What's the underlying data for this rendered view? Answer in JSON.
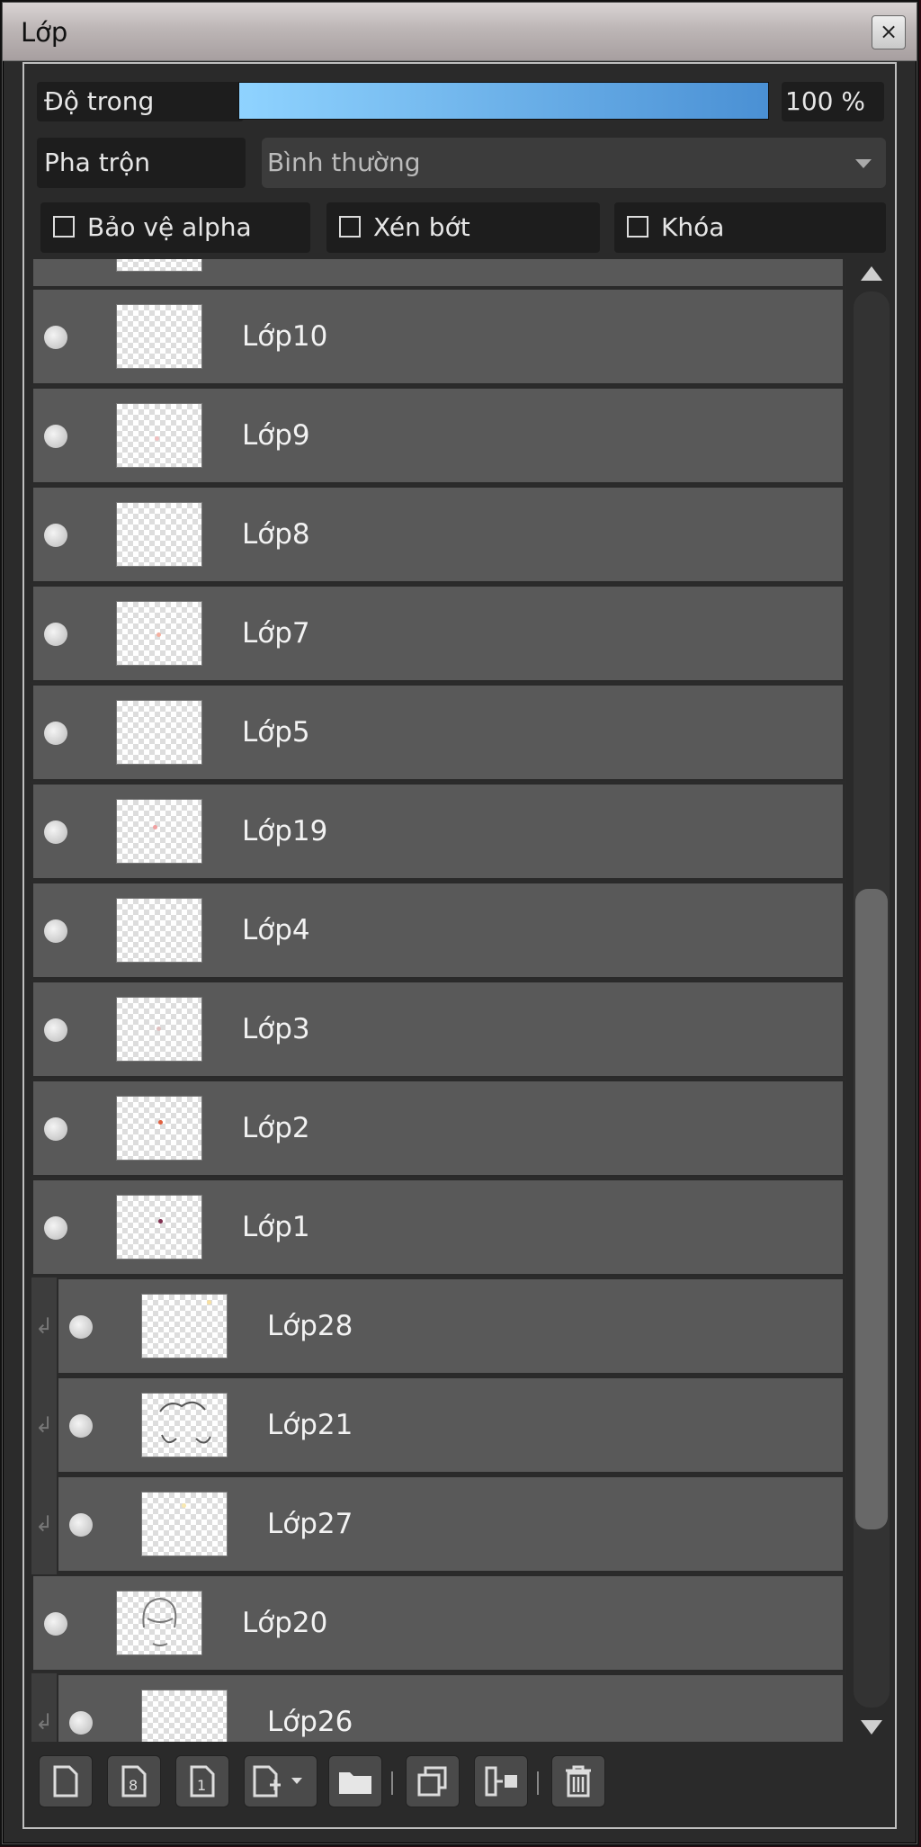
{
  "window": {
    "title": "Lớp",
    "close_symbol": "×"
  },
  "controls": {
    "opacity_label": "Độ trong",
    "opacity_value": "100 %",
    "opacity_fraction": 1.0,
    "blend_label": "Pha trộn",
    "blend_value": "Bình thường",
    "checkboxes": [
      {
        "label": "Bảo vệ alpha",
        "checked": false
      },
      {
        "label": "Xén bớt",
        "checked": false
      },
      {
        "label": "Khóa",
        "checked": false
      }
    ]
  },
  "layers": [
    {
      "name": "Lớp10",
      "clipped": false,
      "visible": true
    },
    {
      "name": "Lớp9",
      "clipped": false,
      "visible": true
    },
    {
      "name": "Lớp8",
      "clipped": false,
      "visible": true
    },
    {
      "name": "Lớp7",
      "clipped": false,
      "visible": true
    },
    {
      "name": "Lớp5",
      "clipped": false,
      "visible": true
    },
    {
      "name": "Lớp19",
      "clipped": false,
      "visible": true
    },
    {
      "name": "Lớp4",
      "clipped": false,
      "visible": true
    },
    {
      "name": "Lớp3",
      "clipped": false,
      "visible": true
    },
    {
      "name": "Lớp2",
      "clipped": false,
      "visible": true
    },
    {
      "name": "Lớp1",
      "clipped": false,
      "visible": true
    },
    {
      "name": "Lớp28",
      "clipped": true,
      "visible": true
    },
    {
      "name": "Lớp21",
      "clipped": true,
      "visible": true
    },
    {
      "name": "Lớp27",
      "clipped": true,
      "visible": true
    },
    {
      "name": "Lớp20",
      "clipped": false,
      "visible": true
    },
    {
      "name": "Lớp26",
      "clipped": true,
      "visible": true
    }
  ],
  "scroll": {
    "position_fraction": 0.45,
    "visible_fraction": 0.45
  },
  "toolbar": [
    {
      "name": "new-layer-button",
      "icon": "page-icon"
    },
    {
      "name": "new-8bit-layer-button",
      "icon": "page-8-icon"
    },
    {
      "name": "new-1bit-layer-button",
      "icon": "page-1-icon"
    },
    {
      "name": "add-layer-menu-button",
      "icon": "page-plus-dropdown-icon"
    },
    {
      "name": "new-folder-button",
      "icon": "folder-icon"
    },
    {
      "name": "duplicate-layer-button",
      "icon": "duplicate-icon"
    },
    {
      "name": "merge-down-button",
      "icon": "merge-icon"
    },
    {
      "name": "delete-layer-button",
      "icon": "trash-icon"
    }
  ]
}
